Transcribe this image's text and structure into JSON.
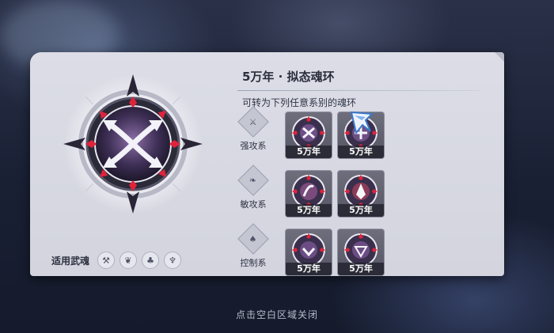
{
  "panel": {
    "title": "5万年 · 拟态魂环",
    "subtitle": "可转为下列任意系别的魂环"
  },
  "weapons": {
    "label": "适用武魂",
    "icons": [
      "axe-icon",
      "wing-icon",
      "sprout-icon",
      "totem-icon"
    ]
  },
  "categories": [
    {
      "label": "强攻系",
      "icon": "attack-icon",
      "rings": [
        {
          "label": "5万年"
        },
        {
          "label": "5万年"
        }
      ]
    },
    {
      "label": "敏攻系",
      "icon": "feather-icon",
      "rings": [
        {
          "label": "5万年"
        },
        {
          "label": "5万年"
        }
      ]
    },
    {
      "label": "控制系",
      "icon": "leaf-icon",
      "rings": [
        {
          "label": "5万年"
        },
        {
          "label": "5万年"
        }
      ]
    }
  ],
  "hint": "点击空白区域关闭",
  "colors": {
    "panel": "#d6d7e0",
    "accent_red": "#e0233a",
    "ring_tile": "#5f5e6e"
  }
}
